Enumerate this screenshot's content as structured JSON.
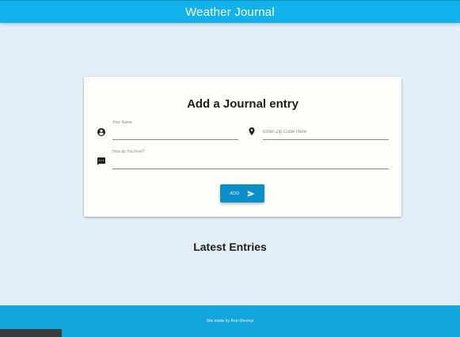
{
  "header": {
    "title": "Weather Journal"
  },
  "form": {
    "title": "Add a Journal entry",
    "name_label": "Your Name",
    "name_value": "",
    "zip_placeholder": "Enter Zip Code Here",
    "zip_value": "",
    "feelings_label": "How do You Feel?",
    "feelings_value": "",
    "add_label": "ADD"
  },
  "entries": {
    "title": "Latest Entries"
  },
  "footer": {
    "credit": "Site made by Áron Berényi"
  },
  "icons": {
    "name": "account-circle-icon",
    "zip": "location-pin-icon",
    "feelings": "chat-message-icon",
    "add": "send-icon"
  },
  "colors": {
    "header": "#12b2ec",
    "background": "#e1eff8",
    "card": "#fdfdfa",
    "button": "#0a8fc8",
    "footer": "#12a6dc"
  }
}
